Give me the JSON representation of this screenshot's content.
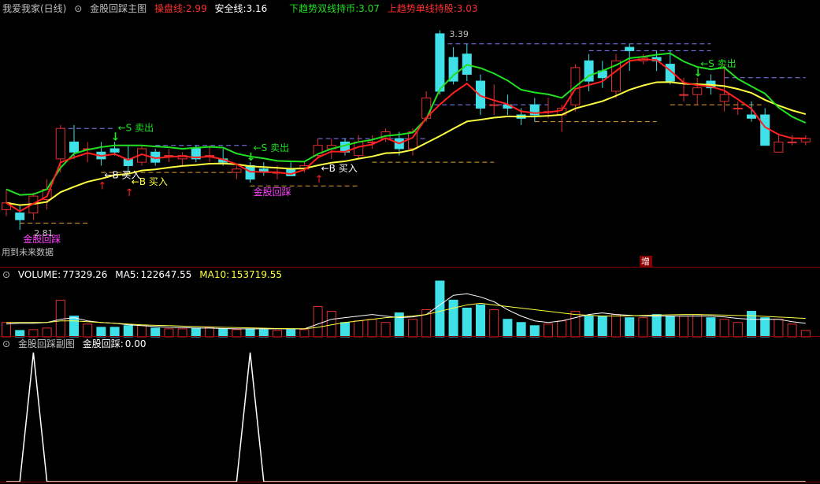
{
  "colors": {
    "bg": "#000000",
    "up": "#e03030",
    "down": "#40e0e8",
    "dash_up": "#8080ff",
    "dash_dn": "#e0a030",
    "red_line": "#ff2020",
    "green_line": "#20e020",
    "yellow_line": "#ffff40",
    "ma5": "#ffffff",
    "ma10": "#ffff40",
    "panel_sep": "#8b0000"
  },
  "main": {
    "panel_title": "我爱我家(日线)",
    "indicator_title": "金股回踩主图",
    "params": [
      {
        "name": "操盘线:",
        "value": "2.99",
        "color": "#ff3030"
      },
      {
        "name": "安全线:",
        "value": "3.16",
        "color": "#ffffff"
      },
      {
        "name": "下趋势双线持币:",
        "value": "3.07",
        "color": "#20e020"
      },
      {
        "name": "上趋势单线持股:",
        "value": "3.03",
        "color": "#ff3030"
      }
    ],
    "future_note": "用到未来数据",
    "marker_zeng": "增",
    "high_label": "3.39",
    "low_label": "2.81",
    "signals": [
      {
        "text": "←S 卖出",
        "color": "#20e020",
        "i": 8
      },
      {
        "text": "←S 卖出",
        "color": "#20e020",
        "i": 18
      },
      {
        "text": "←S 卖出",
        "color": "#20e020",
        "i": 51
      },
      {
        "text": "←B 买入",
        "color": "#ffffff",
        "i": 7
      },
      {
        "text": "←B 买入",
        "color": "#ffff40",
        "i": 9
      },
      {
        "text": "←B 买入",
        "color": "#ffffff",
        "i": 23
      },
      {
        "text": "金股回踩",
        "color": "#ff40ff",
        "i": 1
      },
      {
        "text": "金股回踩",
        "color": "#ff40ff",
        "i": 18
      }
    ]
  },
  "volume": {
    "title": "VOLUME:",
    "value": "77329.26",
    "ma5_label": "MA5:",
    "ma5_value": "122647.55",
    "ma10_label": "MA10:",
    "ma10_value": "153719.55"
  },
  "sub": {
    "title": "金股回踩副图",
    "label": "金股回踩:",
    "value": "0.00"
  },
  "chart_data": {
    "type": "candlestick",
    "ylim": [
      2.78,
      3.42
    ],
    "ohlc": [
      [
        2.87,
        2.93,
        2.85,
        2.89
      ],
      [
        2.86,
        2.88,
        2.81,
        2.84
      ],
      [
        2.86,
        2.92,
        2.84,
        2.91
      ],
      [
        2.9,
        2.96,
        2.87,
        2.93
      ],
      [
        3.02,
        3.12,
        2.98,
        3.11
      ],
      [
        3.07,
        3.12,
        3.02,
        3.04
      ],
      [
        3.05,
        3.07,
        3.01,
        3.05
      ],
      [
        3.04,
        3.07,
        3.0,
        3.02
      ],
      [
        3.05,
        3.07,
        3.03,
        3.04
      ],
      [
        3.02,
        3.06,
        2.98,
        3.0
      ],
      [
        3.01,
        3.06,
        3.0,
        3.05
      ],
      [
        3.04,
        3.05,
        3.0,
        3.01
      ],
      [
        3.03,
        3.05,
        3.01,
        3.03
      ],
      [
        3.02,
        3.04,
        3.0,
        3.03
      ],
      [
        3.05,
        3.06,
        3.01,
        3.02
      ],
      [
        3.03,
        3.06,
        3.01,
        3.03
      ],
      [
        3.02,
        3.05,
        3.0,
        3.01
      ],
      [
        2.98,
        3.0,
        2.96,
        2.99
      ],
      [
        3.0,
        3.01,
        2.95,
        2.96
      ],
      [
        2.99,
        3.01,
        2.97,
        2.98
      ],
      [
        2.98,
        3.0,
        2.96,
        2.98
      ],
      [
        2.99,
        3.01,
        2.97,
        2.97
      ],
      [
        2.99,
        3.01,
        2.98,
        3.0
      ],
      [
        3.03,
        3.08,
        3.02,
        3.06
      ],
      [
        3.05,
        3.08,
        3.02,
        3.06
      ],
      [
        3.07,
        3.08,
        3.03,
        3.04
      ],
      [
        3.03,
        3.09,
        3.02,
        3.07
      ],
      [
        3.07,
        3.09,
        3.05,
        3.07
      ],
      [
        3.08,
        3.11,
        3.07,
        3.1
      ],
      [
        3.08,
        3.1,
        3.03,
        3.05
      ],
      [
        3.05,
        3.11,
        3.03,
        3.1
      ],
      [
        3.14,
        3.22,
        3.13,
        3.2
      ],
      [
        3.39,
        3.4,
        3.21,
        3.22
      ],
      [
        3.32,
        3.35,
        3.24,
        3.25
      ],
      [
        3.33,
        3.36,
        3.25,
        3.27
      ],
      [
        3.25,
        3.27,
        3.15,
        3.17
      ],
      [
        3.18,
        3.24,
        3.15,
        3.18
      ],
      [
        3.18,
        3.21,
        3.15,
        3.17
      ],
      [
        3.15,
        3.17,
        3.12,
        3.14
      ],
      [
        3.18,
        3.2,
        3.13,
        3.15
      ],
      [
        3.16,
        3.2,
        3.14,
        3.16
      ],
      [
        3.15,
        3.18,
        3.1,
        3.17
      ],
      [
        3.18,
        3.3,
        3.16,
        3.29
      ],
      [
        3.31,
        3.33,
        3.22,
        3.25
      ],
      [
        3.28,
        3.31,
        3.23,
        3.26
      ],
      [
        3.22,
        3.33,
        3.2,
        3.31
      ],
      [
        3.35,
        3.36,
        3.28,
        3.34
      ],
      [
        3.31,
        3.33,
        3.3,
        3.32
      ],
      [
        3.32,
        3.34,
        3.28,
        3.31
      ],
      [
        3.3,
        3.34,
        3.24,
        3.25
      ],
      [
        3.21,
        3.26,
        3.19,
        3.21
      ],
      [
        3.21,
        3.26,
        3.18,
        3.23
      ],
      [
        3.25,
        3.27,
        3.21,
        3.23
      ],
      [
        3.19,
        3.3,
        3.16,
        3.21
      ],
      [
        3.17,
        3.19,
        3.15,
        3.17
      ],
      [
        3.15,
        3.19,
        3.13,
        3.14
      ],
      [
        3.15,
        3.17,
        3.06,
        3.06
      ],
      [
        3.04,
        3.09,
        3.06,
        3.07
      ],
      [
        3.07,
        3.09,
        3.06,
        3.07
      ],
      [
        3.07,
        3.09,
        3.06,
        3.08
      ]
    ],
    "volume_ylim": [
      0,
      360000
    ],
    "volume": [
      90000,
      40000,
      45000,
      55000,
      230000,
      130000,
      80000,
      60000,
      60000,
      70000,
      70000,
      55000,
      50000,
      50000,
      55000,
      60000,
      50000,
      45000,
      50000,
      45000,
      40000,
      45000,
      45000,
      190000,
      160000,
      90000,
      100000,
      110000,
      90000,
      150000,
      110000,
      170000,
      350000,
      230000,
      180000,
      200000,
      170000,
      110000,
      90000,
      70000,
      80000,
      100000,
      160000,
      130000,
      130000,
      140000,
      120000,
      120000,
      140000,
      130000,
      130000,
      140000,
      120000,
      110000,
      90000,
      160000,
      120000,
      110000,
      80000,
      40000
    ],
    "ma5": [
      80000,
      85000,
      85000,
      90000,
      110000,
      120000,
      100000,
      90000,
      85000,
      75000,
      70000,
      65000,
      60000,
      58000,
      55000,
      55000,
      52000,
      50000,
      50000,
      50000,
      50000,
      50000,
      50000,
      80000,
      110000,
      120000,
      130000,
      140000,
      130000,
      120000,
      125000,
      140000,
      200000,
      260000,
      270000,
      250000,
      220000,
      170000,
      130000,
      100000,
      90000,
      100000,
      120000,
      140000,
      150000,
      140000,
      135000,
      130000,
      130000,
      130000,
      130000,
      130000,
      130000,
      125000,
      115000,
      110000,
      110000,
      110000,
      95000,
      85000
    ],
    "ma10": [
      90000,
      90000,
      90000,
      90000,
      100000,
      100000,
      95000,
      90000,
      85000,
      80000,
      75000,
      72000,
      70000,
      67000,
      65000,
      62000,
      60000,
      58000,
      56000,
      54000,
      52000,
      51000,
      50000,
      60000,
      75000,
      90000,
      100000,
      110000,
      120000,
      125000,
      130000,
      140000,
      160000,
      180000,
      200000,
      210000,
      200000,
      190000,
      180000,
      170000,
      160000,
      150000,
      140000,
      135000,
      130000,
      130000,
      132000,
      134000,
      136000,
      138000,
      140000,
      140000,
      138000,
      136000,
      134000,
      132000,
      128000,
      124000,
      120000,
      115000
    ],
    "sub_signal": [
      0,
      0,
      1,
      0,
      0,
      0,
      0,
      0,
      0,
      0,
      0,
      0,
      0,
      0,
      0,
      0,
      0,
      0,
      1,
      0,
      0,
      0,
      0,
      0,
      0,
      0,
      0,
      0,
      0,
      0,
      0,
      0,
      0,
      0,
      0,
      0,
      0,
      0,
      0,
      0,
      0,
      0,
      0,
      0,
      0,
      0,
      0,
      0,
      0,
      0,
      0,
      0,
      0,
      0,
      0,
      0,
      0,
      0,
      0,
      0
    ],
    "buy_arrows": [
      7,
      9,
      23
    ],
    "sell_arrows": [
      8,
      18,
      51
    ]
  }
}
